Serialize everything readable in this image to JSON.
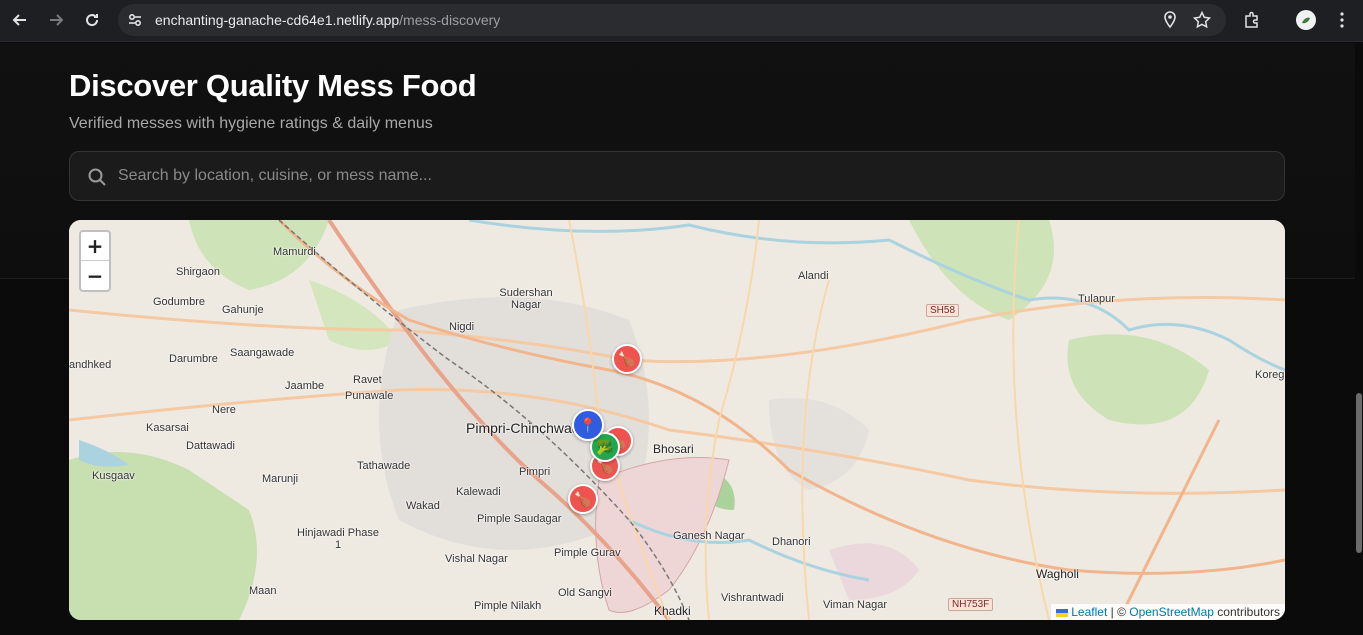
{
  "browser": {
    "url_host": "enchanting-ganache-cd64e1.netlify.app",
    "url_path": "/mess-discovery"
  },
  "hero": {
    "title": "Discover Quality Mess Food",
    "subtitle": "Verified messes with hygiene ratings & daily menus",
    "search_placeholder": "Search by location, cuisine, or mess name..."
  },
  "map": {
    "zoom_in": "+",
    "zoom_out": "−",
    "attribution_leaflet": "Leaflet",
    "attribution_sep": " | © ",
    "attribution_osm": "OpenStreetMap",
    "attribution_suffix": " contributors",
    "places": [
      {
        "name": "Mamurdi"
      },
      {
        "name": "Shirgaon"
      },
      {
        "name": "Godumbre"
      },
      {
        "name": "Gahunje"
      },
      {
        "name": "Sudershan Nagar"
      },
      {
        "name": "Nigdi"
      },
      {
        "name": "Alandi"
      },
      {
        "name": "Tulapur"
      },
      {
        "name": "Darumbre"
      },
      {
        "name": "Saangawade"
      },
      {
        "name": "Jaambe"
      },
      {
        "name": "Ravet"
      },
      {
        "name": "Punawale"
      },
      {
        "name": "Nere"
      },
      {
        "name": "Kasarsai"
      },
      {
        "name": "Dattawadi"
      },
      {
        "name": "Pimpri-Chinchwad"
      },
      {
        "name": "Bhosari"
      },
      {
        "name": "Tathawade"
      },
      {
        "name": "Pimpri"
      },
      {
        "name": "Kusgaav"
      },
      {
        "name": "Marunji"
      },
      {
        "name": "Kalewadi"
      },
      {
        "name": "Wakad"
      },
      {
        "name": "Pimple Saudagar"
      },
      {
        "name": "Hinjawadi Phase 1"
      },
      {
        "name": "Ganesh Nagar"
      },
      {
        "name": "Dhanori"
      },
      {
        "name": "Vishal Nagar"
      },
      {
        "name": "Pimple Gurav"
      },
      {
        "name": "Maan"
      },
      {
        "name": "Old Sangvi"
      },
      {
        "name": "Wagholi"
      },
      {
        "name": "Vishrantwadi"
      },
      {
        "name": "Viman Nagar"
      },
      {
        "name": "Pimple Nilakh"
      },
      {
        "name": "Khadki"
      },
      {
        "name": "andhked"
      },
      {
        "name": "Koregaon"
      }
    ],
    "shields": [
      "SH58",
      "NH753F"
    ],
    "markers": [
      {
        "kind": "mess",
        "icon": "🍗",
        "color": "#ef5350"
      },
      {
        "kind": "user",
        "icon": "📍",
        "color": "#2f5ce0"
      },
      {
        "kind": "mess",
        "icon": "🍗",
        "color": "#ef5350"
      },
      {
        "kind": "cluster",
        "icon": "🥦",
        "color": "#1fa84f"
      },
      {
        "kind": "mess",
        "icon": "🍗",
        "color": "#ef5350"
      },
      {
        "kind": "mess",
        "icon": "🍗",
        "color": "#ef5350"
      }
    ]
  }
}
